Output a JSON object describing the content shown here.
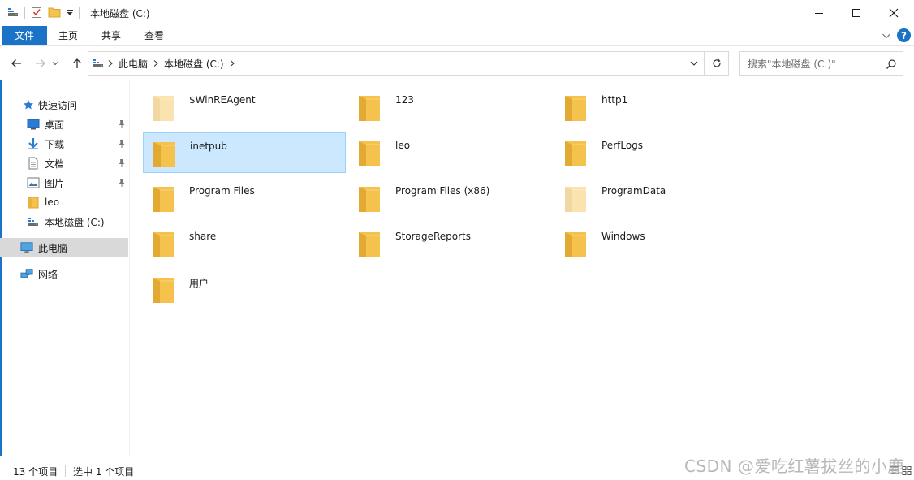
{
  "window": {
    "title": "本地磁盘 (C:)",
    "minimize_icon": "minimize-icon",
    "maximize_icon": "maximize-icon",
    "close_icon": "close-icon"
  },
  "ribbon": {
    "tabs": [
      {
        "label": "文件",
        "active": true
      },
      {
        "label": "主页"
      },
      {
        "label": "共享"
      },
      {
        "label": "查看"
      }
    ],
    "help_label": "?"
  },
  "navigation": {
    "breadcrumb": [
      "此电脑",
      "本地磁盘 (C:)"
    ],
    "search_placeholder": "搜索\"本地磁盘 (C:)\""
  },
  "sidebar": {
    "items": [
      {
        "label": "快速访问",
        "icon": "star-icon"
      },
      {
        "label": "桌面",
        "icon": "desktop-icon",
        "pinned": true
      },
      {
        "label": "下载",
        "icon": "download-icon",
        "pinned": true
      },
      {
        "label": "文档",
        "icon": "document-icon",
        "pinned": true
      },
      {
        "label": "图片",
        "icon": "picture-icon",
        "pinned": true
      },
      {
        "label": "leo",
        "icon": "folder-icon"
      },
      {
        "label": "本地磁盘 (C:)",
        "icon": "drive-icon"
      },
      {
        "label": "此电脑",
        "icon": "computer-icon",
        "selected": true
      },
      {
        "label": "网络",
        "icon": "network-icon"
      }
    ]
  },
  "files": [
    {
      "name": "$WinREAgent",
      "hidden": true
    },
    {
      "name": "123"
    },
    {
      "name": "http1"
    },
    {
      "name": "inetpub",
      "selected": true
    },
    {
      "name": "leo"
    },
    {
      "name": "PerfLogs"
    },
    {
      "name": "Program Files"
    },
    {
      "name": "Program Files (x86)"
    },
    {
      "name": "ProgramData",
      "hidden": true
    },
    {
      "name": "share"
    },
    {
      "name": "StorageReports"
    },
    {
      "name": "Windows"
    },
    {
      "name": "用户"
    }
  ],
  "status": {
    "item_count": "13 个项目",
    "selected_count": "选中 1 个项目"
  },
  "watermark": "CSDN @爱吃红薯拔丝的小鹿",
  "colors": {
    "accent": "#1a73c6",
    "selection_bg": "#cce8ff",
    "selection_border": "#99d1ff",
    "folder": "#f5c24e"
  }
}
